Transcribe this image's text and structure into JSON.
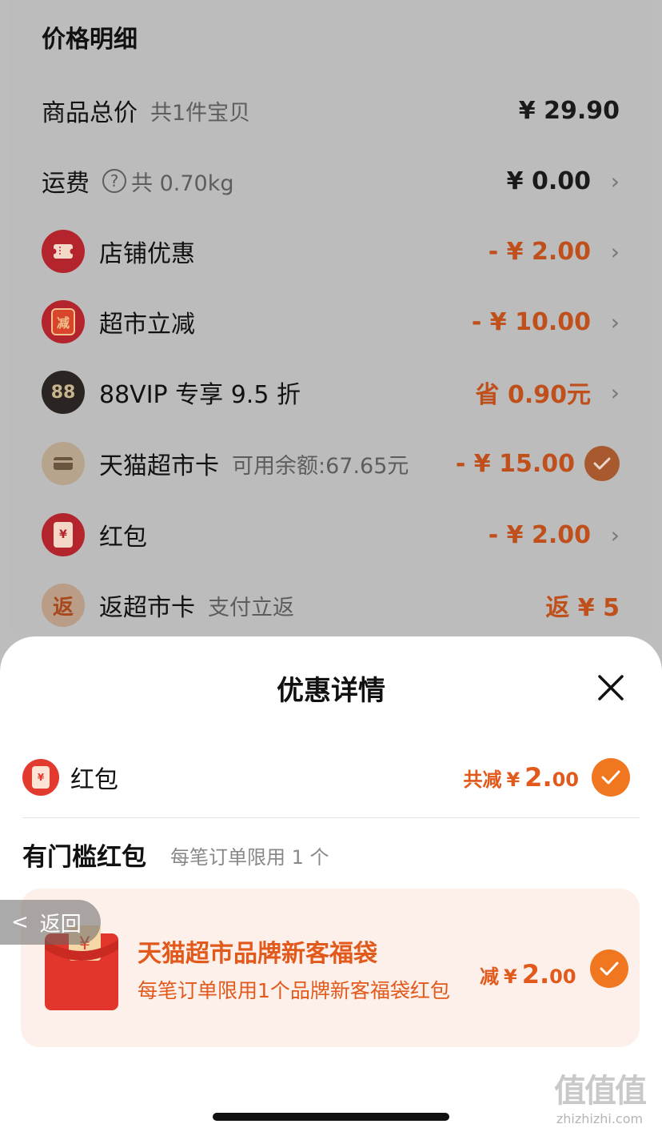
{
  "price_detail": {
    "title": "价格明细",
    "goods_total": {
      "label": "商品总价",
      "sub": "共1件宝贝",
      "amount": "¥ 29.90"
    },
    "shipping": {
      "label": "运费",
      "sub": "共 0.70kg",
      "amount": "¥ 0.00"
    },
    "shop_discount": {
      "label": "店铺优惠",
      "amount": "- ¥ 2.00"
    },
    "market_cut": {
      "label": "超市立减",
      "icon_text": "减",
      "amount": "- ¥ 10.00"
    },
    "vip": {
      "label": "88VIP 专享 9.5 折",
      "icon_text": "88",
      "amount": "省 0.90元"
    },
    "market_card": {
      "label": "天猫超市卡",
      "sub": "可用余额:67.65元",
      "amount": "- ¥ 15.00"
    },
    "red_packet": {
      "label": "红包",
      "amount": "- ¥ 2.00"
    },
    "cashback": {
      "label": "返超市卡",
      "sub": "支付立返",
      "icon_text": "返",
      "amount": "返 ¥ 5"
    }
  },
  "sheet": {
    "title": "优惠详情",
    "red_packet_row": {
      "label": "红包",
      "total_prefix": "共减",
      "currency": "¥",
      "amount_int": "2.",
      "amount_dec": "00"
    },
    "section_title": "有门槛红包",
    "section_sub": "每笔订单限用 1 个",
    "coupon": {
      "name": "天猫超市品牌新客福袋",
      "desc": "每笔订单限用1个品牌新客福袋红包",
      "prefix": "减",
      "currency": "¥",
      "amount_int": "2.",
      "amount_dec": "00"
    }
  },
  "back_button": {
    "label": "返回"
  },
  "watermark": {
    "big": "值值值",
    "small": "zhizhizhi.com"
  },
  "colors": {
    "accent": "#f0761f",
    "discount_red": "#e2591c",
    "dim_bg": "#bdbdbd"
  }
}
